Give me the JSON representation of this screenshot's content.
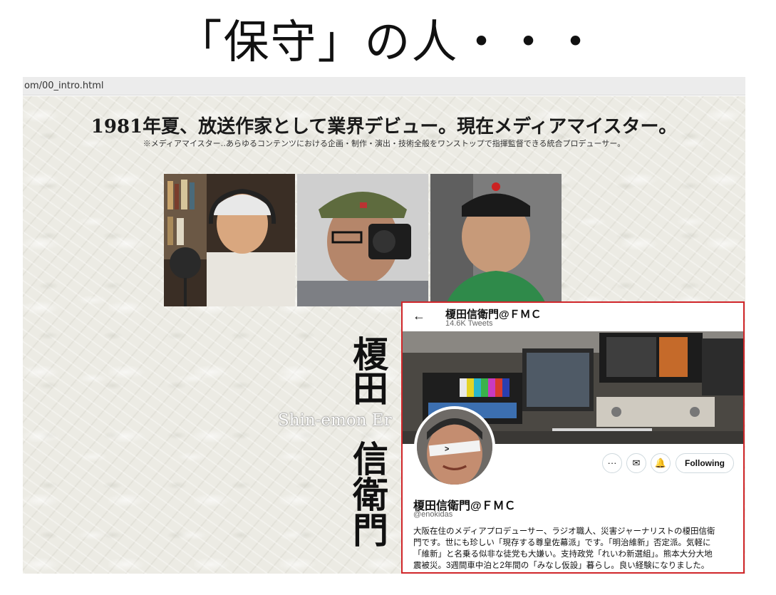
{
  "slide": {
    "title": "「保守」の人・・・"
  },
  "browser": {
    "url": "om/00_intro.html"
  },
  "site": {
    "headline": "1981年夏、放送作家として業界デビュー。現在メディアマイスター。",
    "subline": "※メディアマイスター‥あらゆるコンテンツにおける企画・制作・演出・技術全般をワンストップで指揮監督できる統合プロデューサー。",
    "name_chars": [
      "榎",
      "田",
      "信",
      "衛",
      "門"
    ],
    "romaji": "Shin-emon Er"
  },
  "twitter": {
    "back_icon": "←",
    "display_name": "榎田信衛門@ＦＭＣ",
    "tweet_count": "14.6K Tweets",
    "more_icon": "···",
    "mail_icon": "✉",
    "bell_icon": "🔔",
    "follow_label": "Following",
    "handle": "@enokidas",
    "bio_lines": [
      "大阪在住のメディアプロデューサー、ラジオ職人、災害ジャーナリストの榎田信衛",
      "門です。世にも珍しい「現存する尊皇佐幕派」です。「明治維新」否定派。気軽に",
      "「維新」と名乗る似非な徒党も大嫌い。支持政党「れいわ新選組」。熊本大分大地",
      "震被災。3週間車中泊と2年間の「みなし仮設」暮らし。良い経験になりました。"
    ]
  },
  "colors": {
    "highlight_border": "#d0262a"
  }
}
